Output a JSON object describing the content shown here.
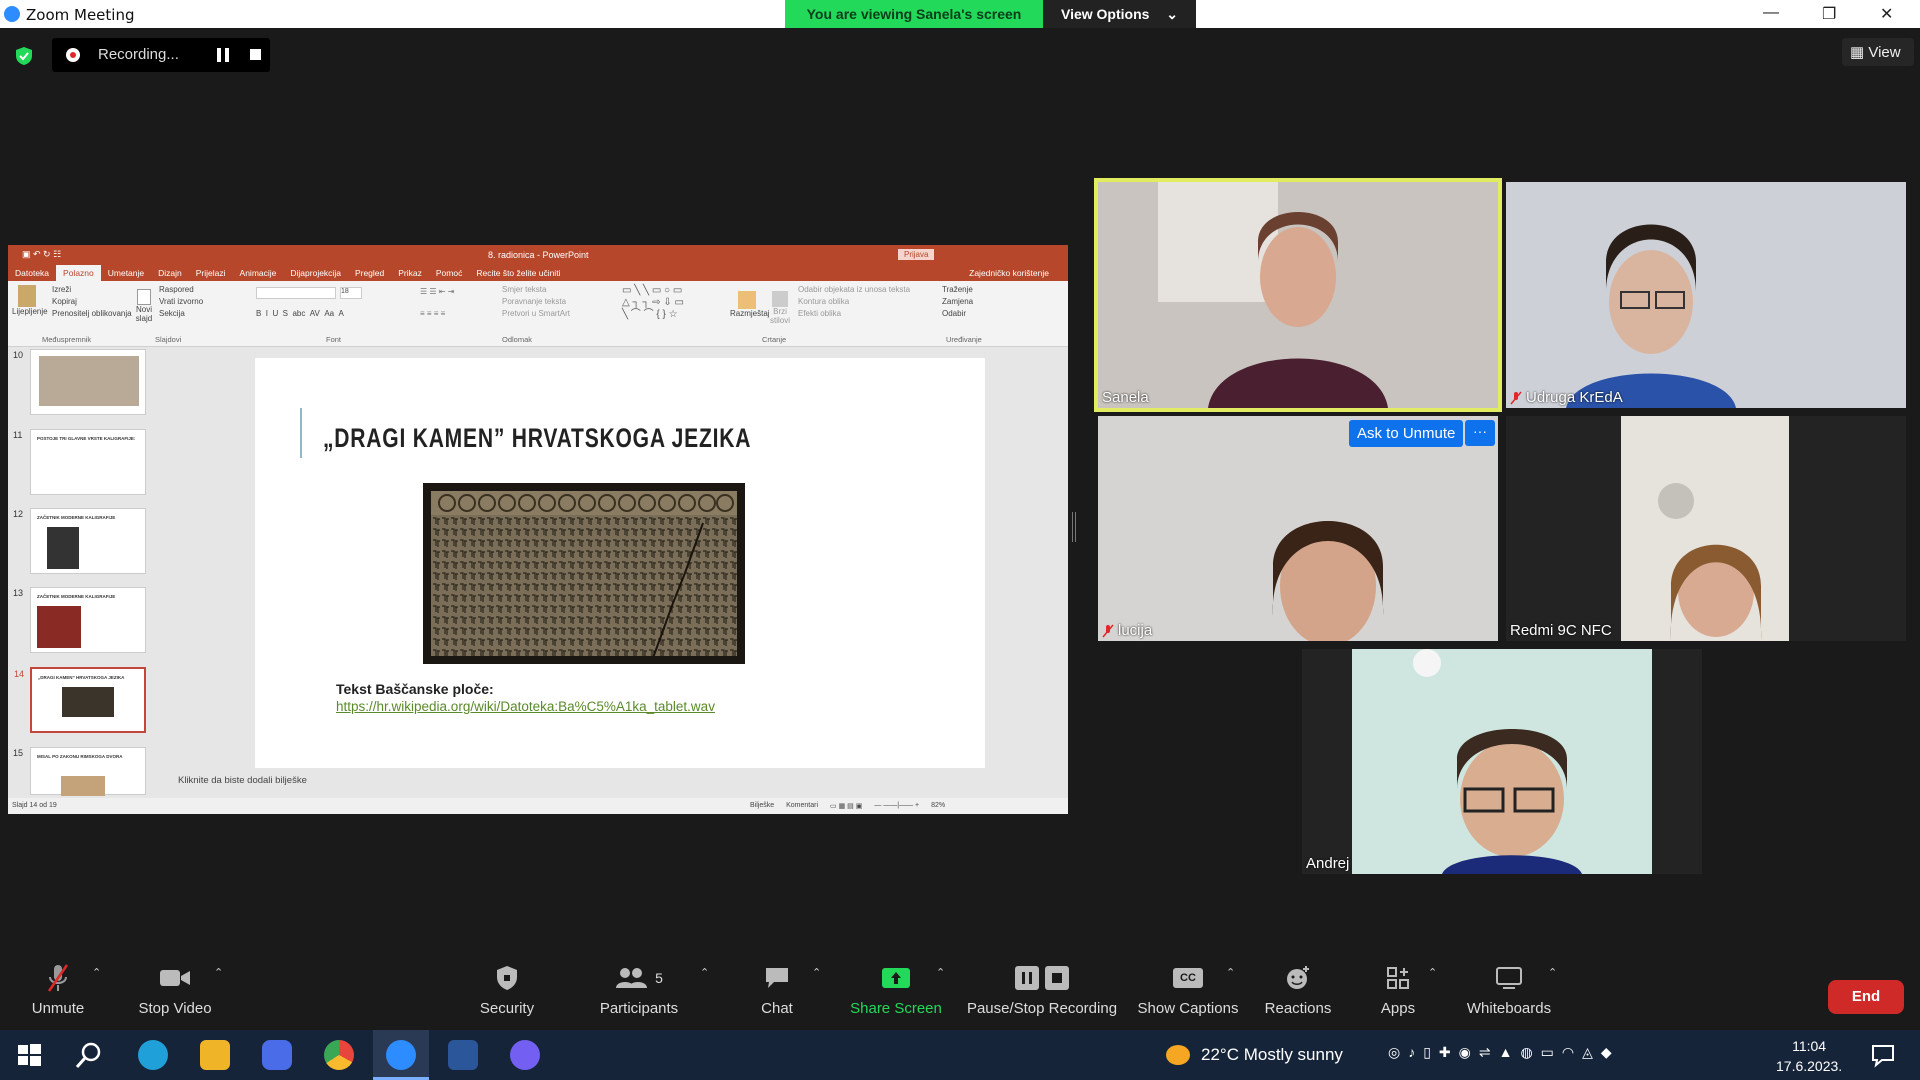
{
  "window": {
    "title": "Zoom Meeting",
    "banner_text": "You are viewing Sanela's screen",
    "view_options_label": "View Options",
    "controls": [
      "—",
      "❐",
      "✕"
    ]
  },
  "top": {
    "recording_label": "Recording...",
    "view_label": "View"
  },
  "ppt": {
    "doc_title": "8. radionica  -  PowerPoint",
    "login": "Prijava",
    "tabs": [
      "Datoteka",
      "Polazno",
      "Umetanje",
      "Dizajn",
      "Prijelazi",
      "Animacije",
      "Dijaprojekcija",
      "Pregled",
      "Prikaz",
      "Pomoć",
      "Recite što želite učiniti"
    ],
    "share": "Zajedničko korištenje",
    "ribbon": {
      "clipboard": {
        "items": [
          "Izreži",
          "Kopiraj",
          "Prenositelj oblikovanja"
        ],
        "paste": "Lijepljenje",
        "name": "Međuspremnik"
      },
      "slides": {
        "items": [
          "Raspored",
          "Vrati izvorno",
          "Sekcija"
        ],
        "new": "Novi slajd",
        "name": "Slajdovi"
      },
      "font": {
        "name": "Font",
        "size": "18"
      },
      "paragraph": {
        "items": [
          "Smjer teksta",
          "Poravnanje teksta",
          "Pretvori u SmartArt"
        ],
        "name": "Odlomak"
      },
      "drawing": {
        "items": [
          "Odabir objekata iz unosa teksta",
          "Kontura oblika",
          "Efekti oblika"
        ],
        "arrange": "Razmještaj",
        "quick": "Brzi stilovi",
        "name": "Crtanje"
      },
      "editing": {
        "items": [
          "Traženje",
          "Zamjena",
          "Odabir"
        ],
        "name": "Uređivanje"
      }
    },
    "thumbnails": [
      {
        "num": "10",
        "title": ""
      },
      {
        "num": "11",
        "title": "POSTOJE TRI GLAVNE VRSTE KALIGRAFIJE:"
      },
      {
        "num": "12",
        "title": "ZAČETNIK MODERNE KALIGRAFIJE"
      },
      {
        "num": "13",
        "title": "ZAČETNIK MODERNE KALIGRAFIJE"
      },
      {
        "num": "14",
        "title": "„DRAGI KAMEN” HRVATSKOGA JEZIKA"
      },
      {
        "num": "15",
        "title": "MISAL PO ZAKONU RIMSKOGA DVORA"
      }
    ],
    "slide": {
      "heading": "„DRAGI KAMEN” HRVATSKOGA JEZIKA",
      "caption": "Tekst Baščanske ploče:",
      "link": "https://hr.wikipedia.org/wiki/Datoteka:Ba%C5%A1ka_tablet.wav"
    },
    "notes_placeholder": "Kliknite da biste dodali bilješke",
    "status": {
      "slide": "Slajd 14 od 19",
      "notes": "Bilješke",
      "comments": "Komentari",
      "zoom": "82%"
    }
  },
  "participants": [
    {
      "name": "Sanela",
      "muted": false,
      "active": true
    },
    {
      "name": "Udruga KrEdA",
      "muted": true
    },
    {
      "name": "lucija",
      "muted": true
    },
    {
      "name": "Redmi 9C NFC",
      "muted": false
    },
    {
      "name": "Andrej",
      "muted": false
    }
  ],
  "tile_actions": {
    "ask_unmute": "Ask to Unmute",
    "more": "···"
  },
  "toolbar": {
    "unmute": "Unmute",
    "stop_video": "Stop Video",
    "security": "Security",
    "participants": "Participants",
    "participants_count": "5",
    "chat": "Chat",
    "share_screen": "Share Screen",
    "recording": "Pause/Stop Recording",
    "captions": "Show Captions",
    "captions_badge": "CC",
    "reactions": "Reactions",
    "apps": "Apps",
    "whiteboards": "Whiteboards",
    "end": "End"
  },
  "taskbar": {
    "weather": "22°C  Mostly sunny",
    "time": "11:04",
    "date": "17.6.2023."
  },
  "colors": {
    "zoom_blue": "#2d8cff",
    "share_green": "#23d959",
    "ppt_red": "#b7472a",
    "end_red": "#cf2a27",
    "active_speaker": "#e2ec61"
  }
}
